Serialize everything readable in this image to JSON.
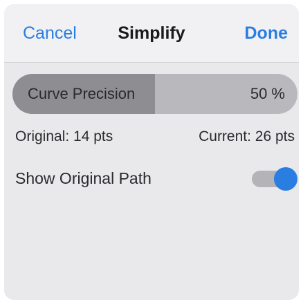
{
  "header": {
    "cancel_label": "Cancel",
    "title": "Simplify",
    "done_label": "Done"
  },
  "precision": {
    "label": "Curve Precision",
    "value_text": "50 %",
    "value": 0.5
  },
  "stats": {
    "original": "Original: 14 pts",
    "current": "Current: 26 pts"
  },
  "show_original": {
    "label": "Show Original Path",
    "enabled": true
  },
  "colors": {
    "accent": "#2a7de1",
    "panel_bg": "#e9e9eb",
    "header_bg": "#f1f1f3",
    "slider_track": "#b9b9bd",
    "slider_fill": "#8e8e92"
  }
}
